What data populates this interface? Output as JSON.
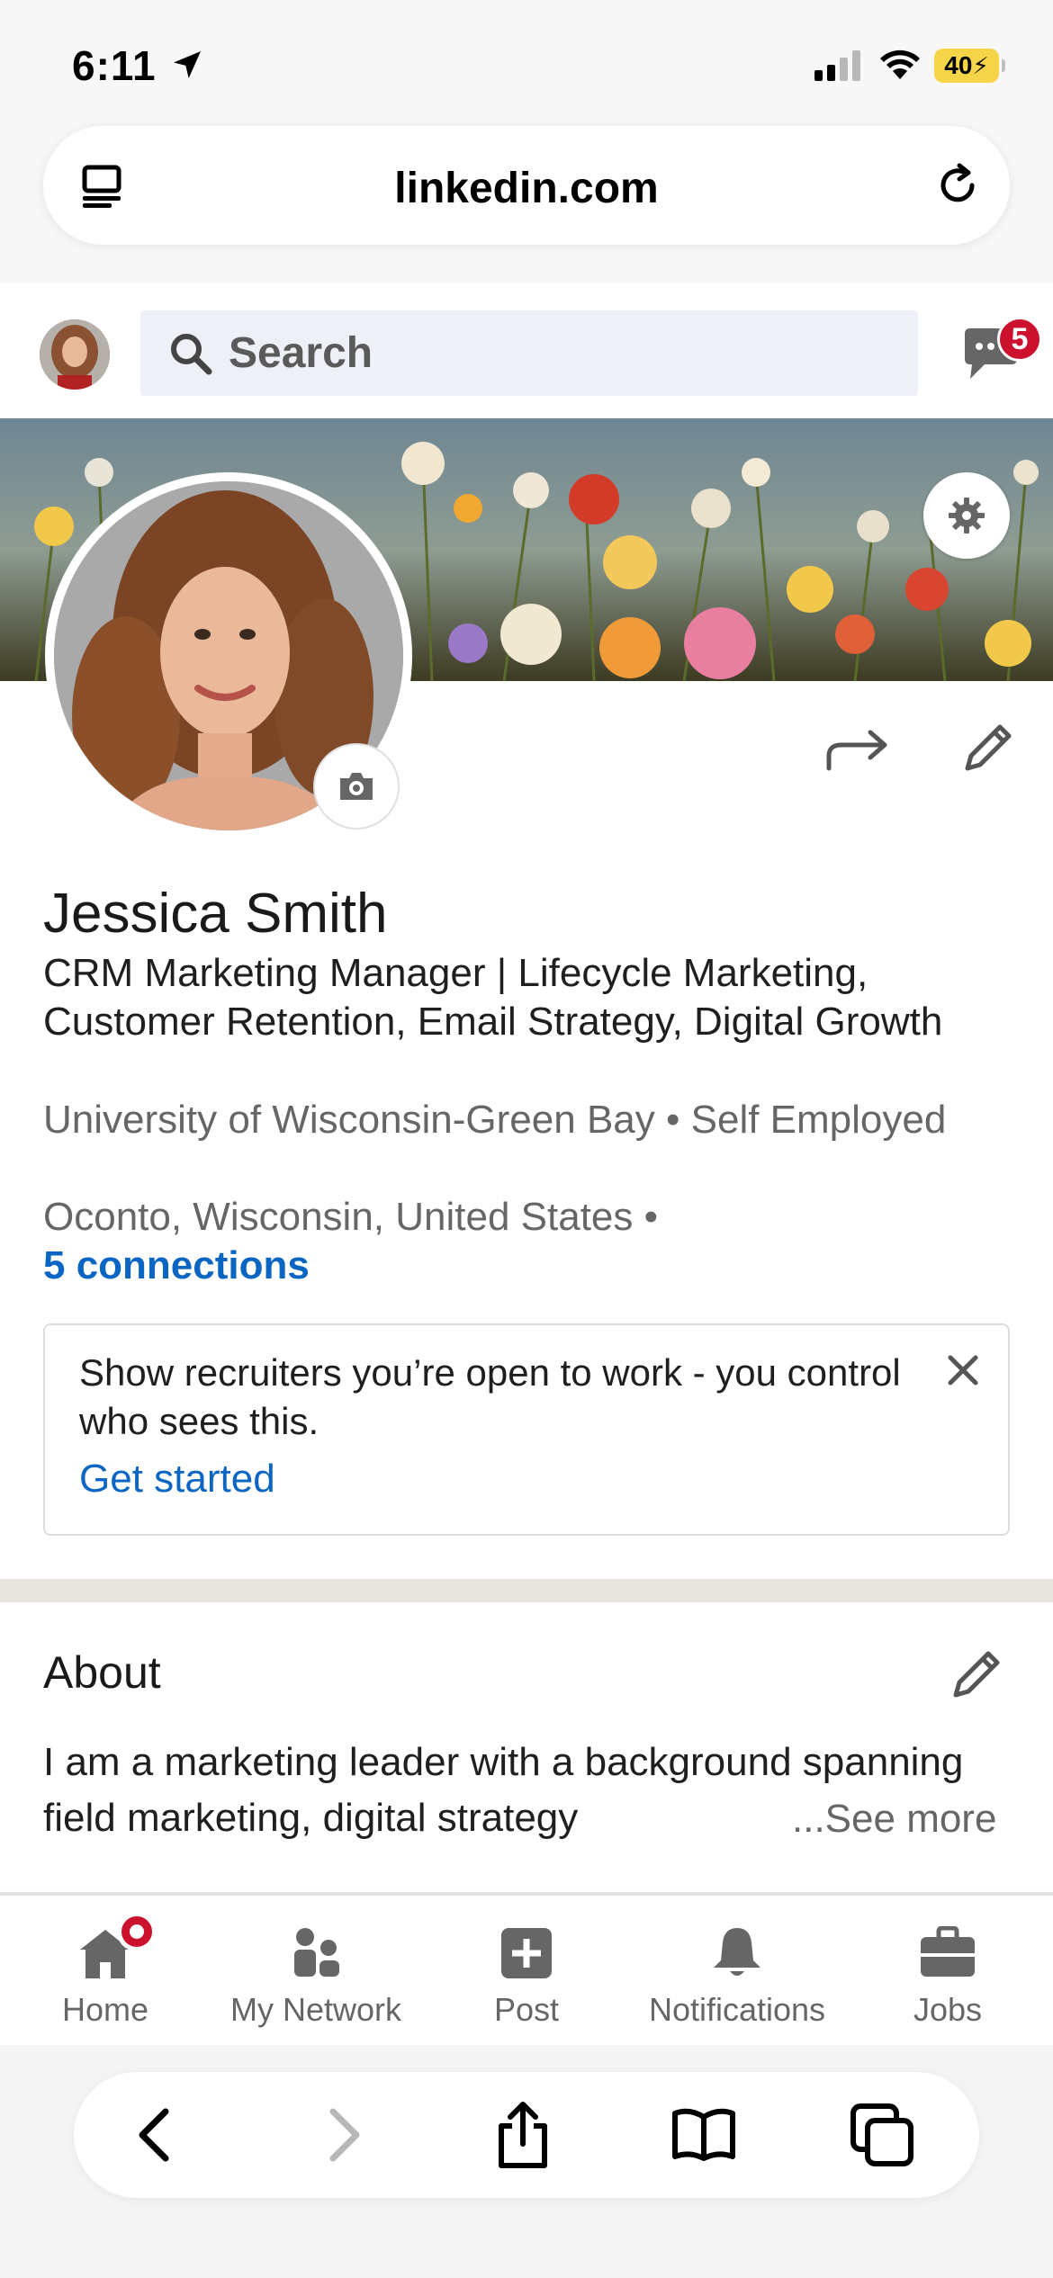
{
  "status_bar": {
    "time": "6:11",
    "battery": "40"
  },
  "browser": {
    "url": "linkedin.com"
  },
  "header": {
    "search_placeholder": "Search",
    "messages_badge": "5"
  },
  "profile": {
    "name": "Jessica Smith",
    "headline": "CRM Marketing Manager | Lifecycle Marketing, Customer Retention, Email Strategy, Digital Growth",
    "education": "University of Wisconsin-Green Bay",
    "employer": "Self Employed",
    "location": "Oconto, Wisconsin, United States",
    "connections": "5 connections"
  },
  "open_to_work": {
    "text": "Show recruiters you’re open to work - you control who sees this.",
    "link": "Get started"
  },
  "about": {
    "title": "About",
    "text": "I am a marketing leader with a background spanning field marketing, digital strategy",
    "see_more": "...See more"
  },
  "nav": {
    "items": [
      {
        "label": "Home"
      },
      {
        "label": "My Network"
      },
      {
        "label": "Post"
      },
      {
        "label": "Notifications"
      },
      {
        "label": "Jobs"
      }
    ]
  },
  "colors": {
    "brand_blue": "#0a66c2",
    "badge_red": "#cb112d"
  }
}
